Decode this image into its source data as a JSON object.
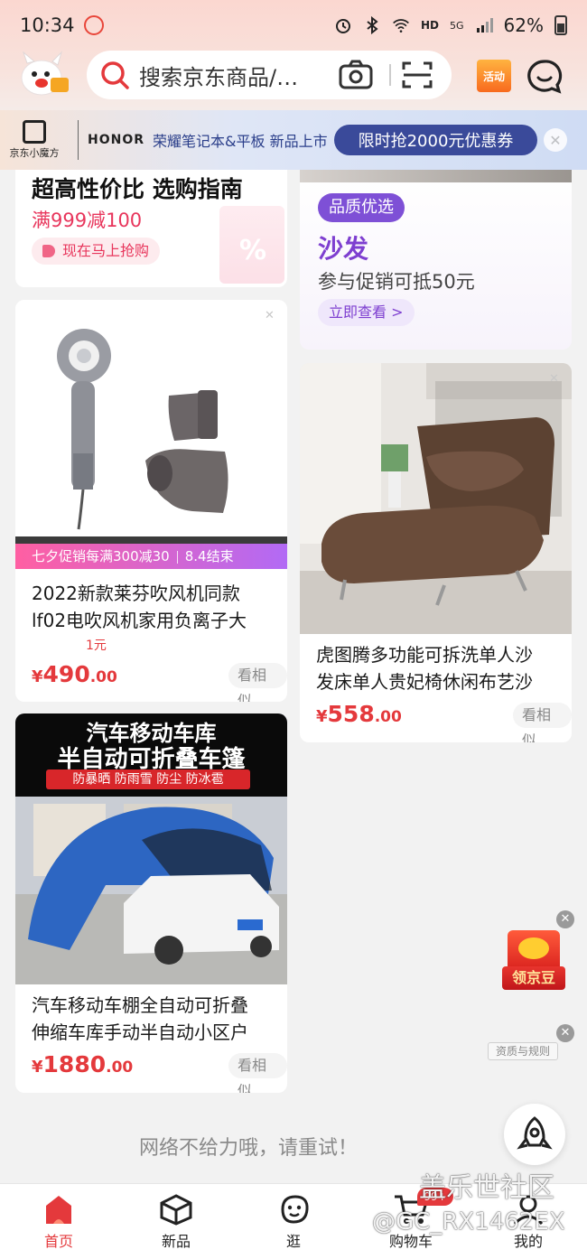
{
  "status_bar": {
    "time": "10:34",
    "network": "HD",
    "signal": "5G",
    "battery": "62%"
  },
  "header": {
    "search_placeholder": "搜索京东商品/…",
    "activity_label": "活动"
  },
  "ad_banner": {
    "brand_sub": "京东小魔方",
    "brand_partner": "HONOR",
    "text": "荣耀笔记本&平板 新品上市",
    "pill": "限时抢2000元优惠券"
  },
  "promo_left": {
    "title": "超高性价比 选购指南",
    "subtitle": "满999减100",
    "cta": "现在马上抢购"
  },
  "promo_right": {
    "badge": "品质优选",
    "category": "沙发",
    "desc": "参与促销可抵50元",
    "cta": "立即查看 >"
  },
  "products": [
    {
      "promo": "七夕促销每满300减30",
      "promo_end": "8.4结束",
      "title_line1": "2022新款莱芬吹风机同款",
      "title_line2": "lf02电吹风机家用负离子大",
      "tag": "1元",
      "price_currency": "¥",
      "price_int": "490",
      "price_dec": ".00",
      "similar": "看相似"
    },
    {
      "title_line1": "虎图腾多功能可拆洗单人沙",
      "title_line2": "发床单人贵妃椅休闲布艺沙",
      "price_currency": "¥",
      "price_int": "558",
      "price_dec": ".00",
      "similar": "看相似"
    },
    {
      "banner_line1": "汽车移动车库",
      "banner_line2": "半自动可折叠车篷",
      "banner_line3": "防暴晒 防雨雪 防尘 防冰雹",
      "title_line1": "汽车移动车棚全自动可折叠",
      "title_line2": "伸缩车库手动半自动小区户",
      "price_currency": "¥",
      "price_int": "1880",
      "price_dec": ".00",
      "similar": "看相似"
    }
  ],
  "floating": {
    "bean_label": "领京豆",
    "qualification": "资质与规则"
  },
  "network_message": "网络不给力哦，请重试！",
  "tabs": [
    {
      "label": "首页",
      "icon": "home-icon",
      "active": true
    },
    {
      "label": "新品",
      "icon": "new-cube-icon"
    },
    {
      "label": "逛",
      "icon": "browse-face-icon"
    },
    {
      "label": "购物车",
      "icon": "cart-icon"
    },
    {
      "label": "我的",
      "icon": "profile-icon"
    }
  ],
  "watermark": {
    "line1": "盖乐世社区",
    "line2": "@GC_RX1462EX"
  },
  "colors": {
    "accent_red": "#e4393c",
    "purple": "#7e50d6",
    "banner_navy": "#3a4a9a"
  }
}
